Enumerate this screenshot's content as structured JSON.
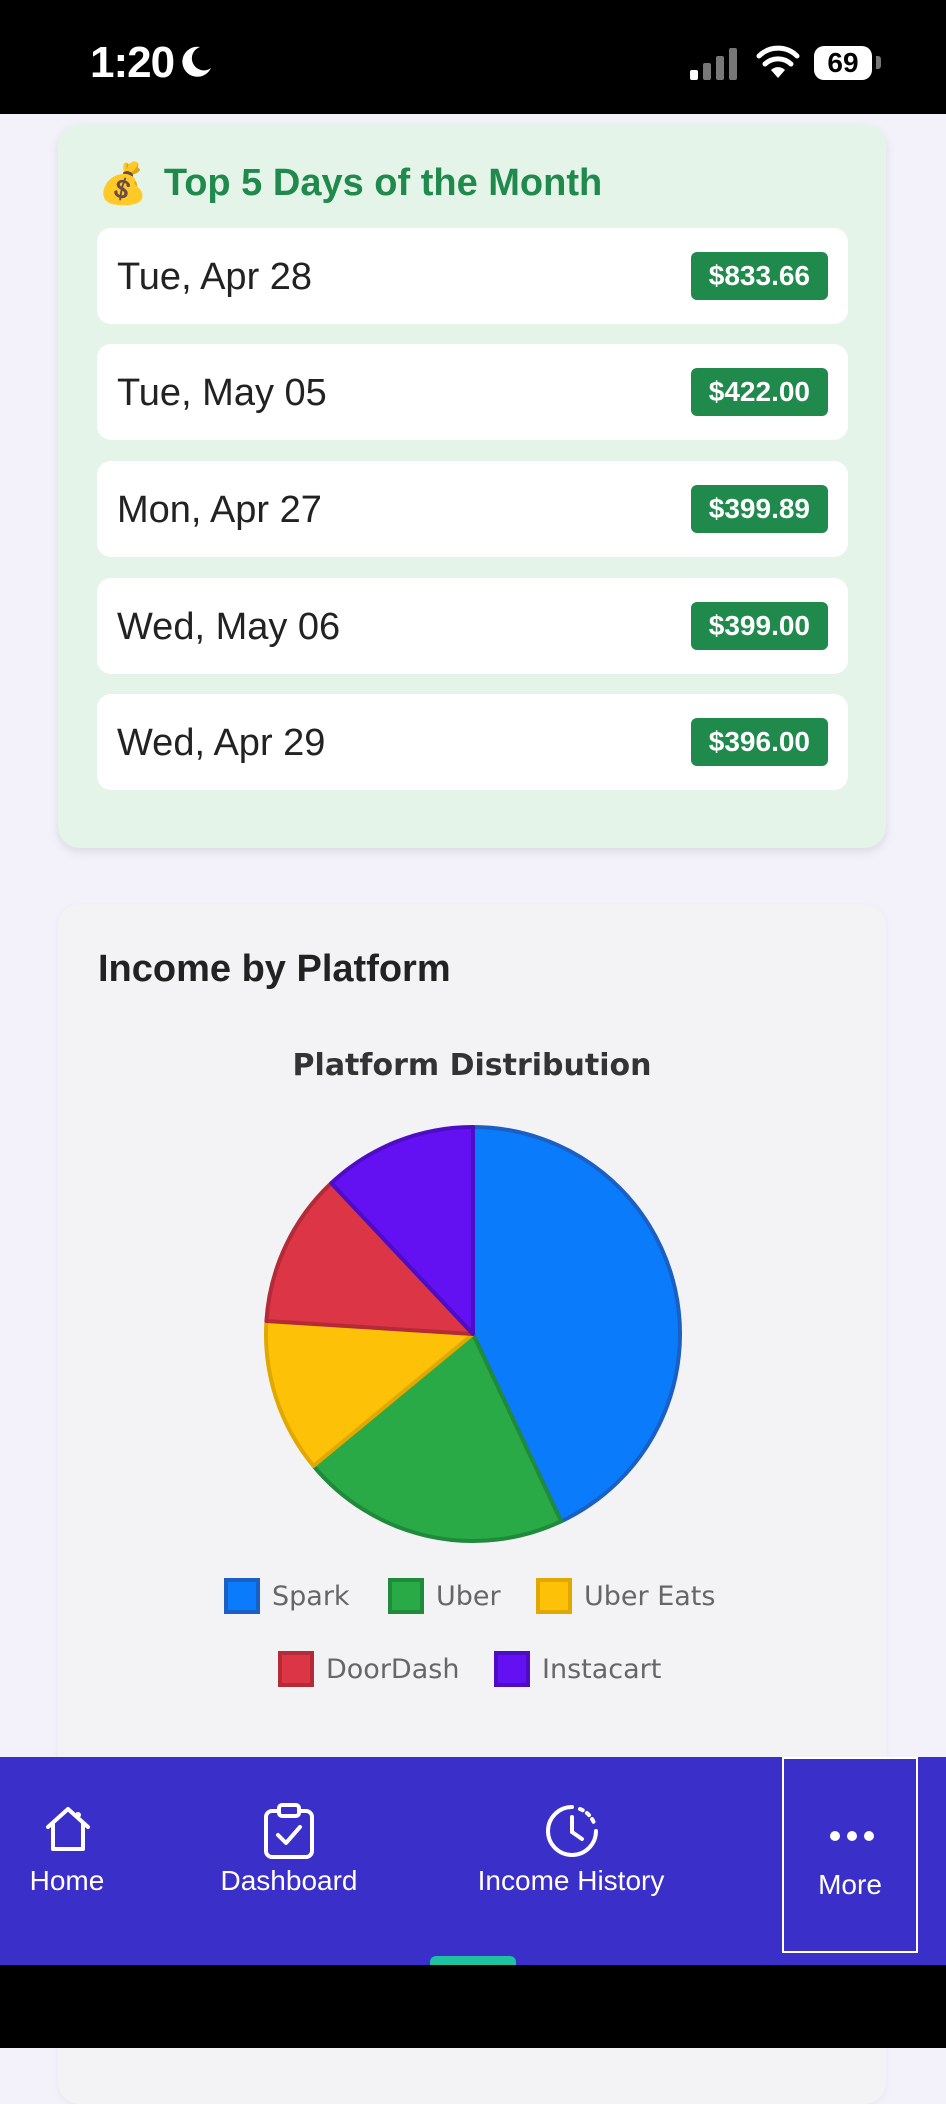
{
  "status_bar": {
    "time": "1:20",
    "battery": "69"
  },
  "top_days": {
    "icon": "money-bag-icon",
    "title": "Top 5 Days of the Month",
    "rows": [
      {
        "date": "Tue, Apr 28",
        "amount": "$833.66"
      },
      {
        "date": "Tue, May 05",
        "amount": "$422.00"
      },
      {
        "date": "Mon, Apr 27",
        "amount": "$399.89"
      },
      {
        "date": "Wed, May 06",
        "amount": "$399.00"
      },
      {
        "date": "Wed, Apr 29",
        "amount": "$396.00"
      }
    ]
  },
  "platform_section": {
    "title": "Income by Platform"
  },
  "chart_data": {
    "type": "pie",
    "title": "Platform Distribution",
    "legend_position": "bottom",
    "slices": [
      {
        "label": "Spark",
        "value": 43,
        "color": "#0a7cfb",
        "border": "#1a5fc4"
      },
      {
        "label": "Uber",
        "value": 21,
        "color": "#2aaa47",
        "border": "#1f8a3a"
      },
      {
        "label": "Uber Eats",
        "value": 12,
        "color": "#fdc107",
        "border": "#e0a800"
      },
      {
        "label": "DoorDash",
        "value": 12,
        "color": "#dc3545",
        "border": "#b52a37"
      },
      {
        "label": "Instacart",
        "value": 12,
        "color": "#6311f2",
        "border": "#4e0cc4"
      }
    ]
  },
  "bottom_nav": {
    "items": [
      {
        "label": "Home",
        "icon": "home-icon"
      },
      {
        "label": "Dashboard",
        "icon": "clipboard-check-icon"
      },
      {
        "label": "Income History",
        "icon": "clock-history-icon"
      },
      {
        "label": "More",
        "icon": "more-dots-icon"
      }
    ]
  }
}
